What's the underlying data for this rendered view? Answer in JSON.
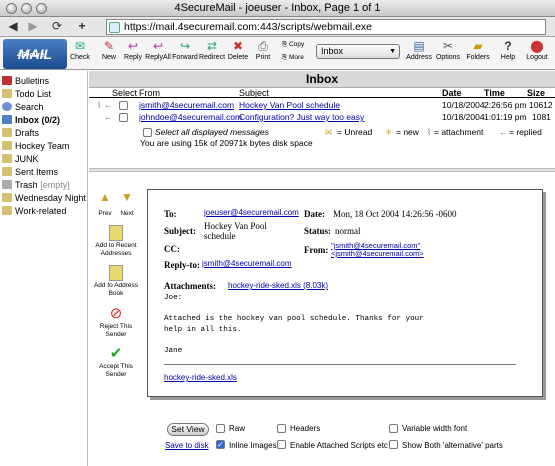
{
  "window": {
    "title": "4SecureMail - joeuser - Inbox, Page 1 of 1"
  },
  "address": {
    "url": "https://mail.4securemail.com:443/scripts/webmail.exe",
    "back": "◀",
    "forward": "▶",
    "reload": "⟳"
  },
  "toolbar": {
    "logo_top": "4Secure",
    "logo_main": "MAIL",
    "buttons": [
      "Check",
      "New",
      "Reply",
      "ReplyAll",
      "Forward",
      "Redirect",
      "Delete",
      "Print"
    ],
    "copy_label": "Copy",
    "move_label": "More",
    "folder_select": "Inbox",
    "right_buttons": [
      "Address",
      "Options",
      "Folders",
      "Help",
      "Logout"
    ]
  },
  "sidebar": {
    "items": [
      {
        "label": "Bulletins",
        "color": "#c03030"
      },
      {
        "label": "Todo List",
        "color": "#d4c070"
      },
      {
        "label": "Search",
        "color": "#7090d0"
      },
      {
        "label": "Inbox (0/2)",
        "color": "#5080c0"
      },
      {
        "label": "Drafts",
        "color": "#d4c070"
      },
      {
        "label": "Hockey Team",
        "color": "#d4c070"
      },
      {
        "label": "JUNK",
        "color": "#d4c070"
      },
      {
        "label": "Sent Items",
        "color": "#d4c070"
      },
      {
        "label": "Trash",
        "extra": "[empty]",
        "color": "#aaaaaa"
      },
      {
        "label": "Wednesday Night",
        "color": "#d4c070"
      },
      {
        "label": "Work-related",
        "color": "#d4c070"
      }
    ]
  },
  "inbox": {
    "title": "Inbox",
    "columns": {
      "select": "Select",
      "from": "From",
      "subject": "Subject",
      "date": "Date",
      "time": "Time",
      "size": "Size"
    },
    "rows": [
      {
        "from": "jsmith@4securemail.com",
        "subject": "Hockey Van Pool schedule",
        "date": "10/18/2004",
        "time": "2:26:56 pm",
        "size": "10612"
      },
      {
        "from": "johndoe@4securemail.com",
        "subject": "Configuration? Just way too easy",
        "date": "10/18/2004",
        "time": "1:01:19 pm",
        "size": "1081"
      }
    ],
    "select_all": "Select all displayed messages",
    "quota": "You are using 15k of 20971k bytes disk space",
    "legend_unread": "= Unread",
    "legend_new": "= new",
    "legend_attach": "= attachment",
    "legend_replied": "= replied"
  },
  "actions": {
    "prev": "Prev",
    "next": "Next",
    "add_recent": "Add to Recent Addresses",
    "add_book": "Add to Address Book",
    "reject": "Reject This Sender",
    "accept": "Accept This Sender"
  },
  "message": {
    "to_label": "To:",
    "to": "joeuser@4securemail.com",
    "date_label": "Date:",
    "date": "Mon, 18 Oct 2004 14:26:56 -0600",
    "subject_label": "Subject:",
    "subject_line1": "Hockey Van Pool",
    "subject_line2": "schedule",
    "status_label": "Status:",
    "status": "normal",
    "cc_label": "CC:",
    "from_label": "From:",
    "from_line1": "\"jsmith@4securemail.com\"",
    "from_line2": "<jsmith@4securemail.com>",
    "replyto_label": "Reply-to:",
    "replyto": "jsmith@4securemail.com",
    "attach_label": "Attachments:",
    "attachment": "hockey-ride-sked.xls (8.03k)",
    "body": "Joe:\n\nAttached is the hockey van pool schedule. Thanks for your\nhelp in all this.\n\nJane",
    "attach_link": "hockey-ride-sked.xls"
  },
  "bottom": {
    "set_view": "Set View",
    "raw": "Raw",
    "headers": "Headers",
    "variable_width": "Variable width font",
    "save": "Save to disk",
    "inline_images": "Inline Images",
    "enable_scripts": "Enable Attached Scripts etc",
    "show_both": "Show Both 'alternative' parts"
  }
}
